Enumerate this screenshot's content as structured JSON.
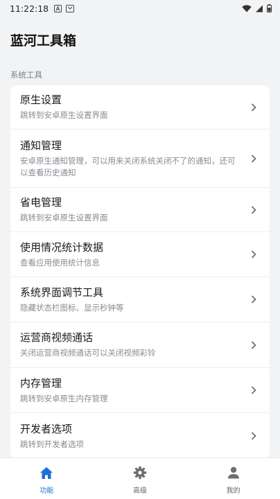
{
  "status_bar": {
    "time": "11:22:18"
  },
  "header": {
    "title": "蓝河工具箱"
  },
  "section": {
    "label": "系统工具"
  },
  "items": [
    {
      "title": "原生设置",
      "subtitle": "跳转到安卓原生设置界面"
    },
    {
      "title": "通知管理",
      "subtitle": "安卓原生通知管理，可以用来关闭系统关闭不了的通知，还可以查看历史通知"
    },
    {
      "title": "省电管理",
      "subtitle": "跳转到安卓原生设置界面"
    },
    {
      "title": "使用情况统计数据",
      "subtitle": "查看应用使用统计信息"
    },
    {
      "title": "系统界面调节工具",
      "subtitle": "隐藏状态栏图标、显示秒钟等"
    },
    {
      "title": "运营商视频通话",
      "subtitle": "关闭运营商视频通话可以关闭视频彩铃"
    },
    {
      "title": "内存管理",
      "subtitle": "跳转到安卓原生内存管理"
    },
    {
      "title": "开发者选项",
      "subtitle": "跳转到开发者选项"
    }
  ],
  "bottom_nav": [
    {
      "label": "功能",
      "icon": "home-icon",
      "active": true
    },
    {
      "label": "高级",
      "icon": "gear-icon",
      "active": false
    },
    {
      "label": "我的",
      "icon": "person-icon",
      "active": false
    }
  ],
  "colors": {
    "accent": "#1f6fd6",
    "background": "#f2f3f5",
    "card": "#ffffff"
  }
}
